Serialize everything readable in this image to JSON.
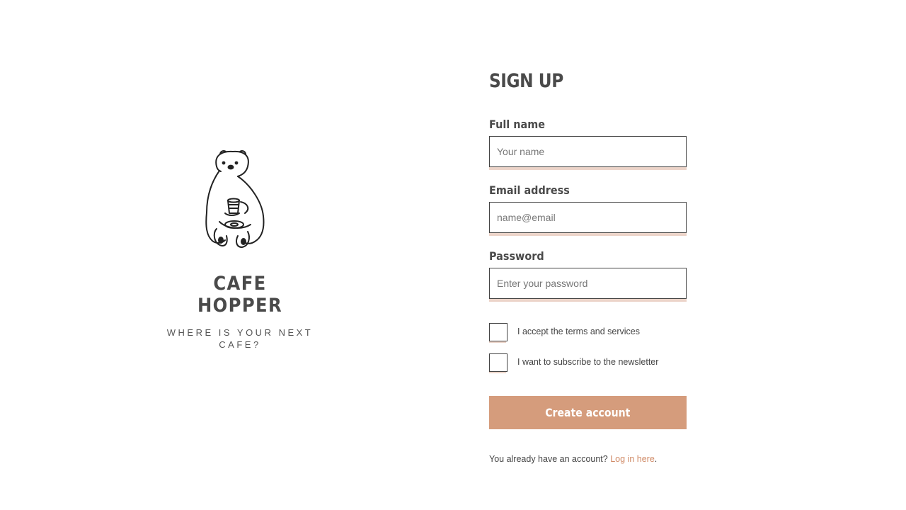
{
  "brand": {
    "name": "CAFE HOPPER",
    "tagline": "WHERE IS YOUR NEXT CAFE?",
    "logo_icon": "polar-bear-with-coffee-icon"
  },
  "form": {
    "title": "SIGN UP",
    "full_name": {
      "label": "Full name",
      "placeholder": "Your name",
      "value": ""
    },
    "email": {
      "label": "Email address",
      "placeholder": "name@email",
      "value": ""
    },
    "password": {
      "label": "Password",
      "placeholder": "Enter your password",
      "value": ""
    },
    "terms": {
      "label": "I accept the terms and services",
      "checked": false
    },
    "newsletter": {
      "label": "I want to subscribe to the newsletter",
      "checked": false
    },
    "submit_label": "Create account",
    "login_prompt": "You already have an account?",
    "login_link": "Log in here",
    "login_suffix": "."
  },
  "colors": {
    "accent": "#d59c7c",
    "accent_light": "#ecd4c9",
    "link": "#d08a66",
    "text": "#4a4a4a"
  }
}
